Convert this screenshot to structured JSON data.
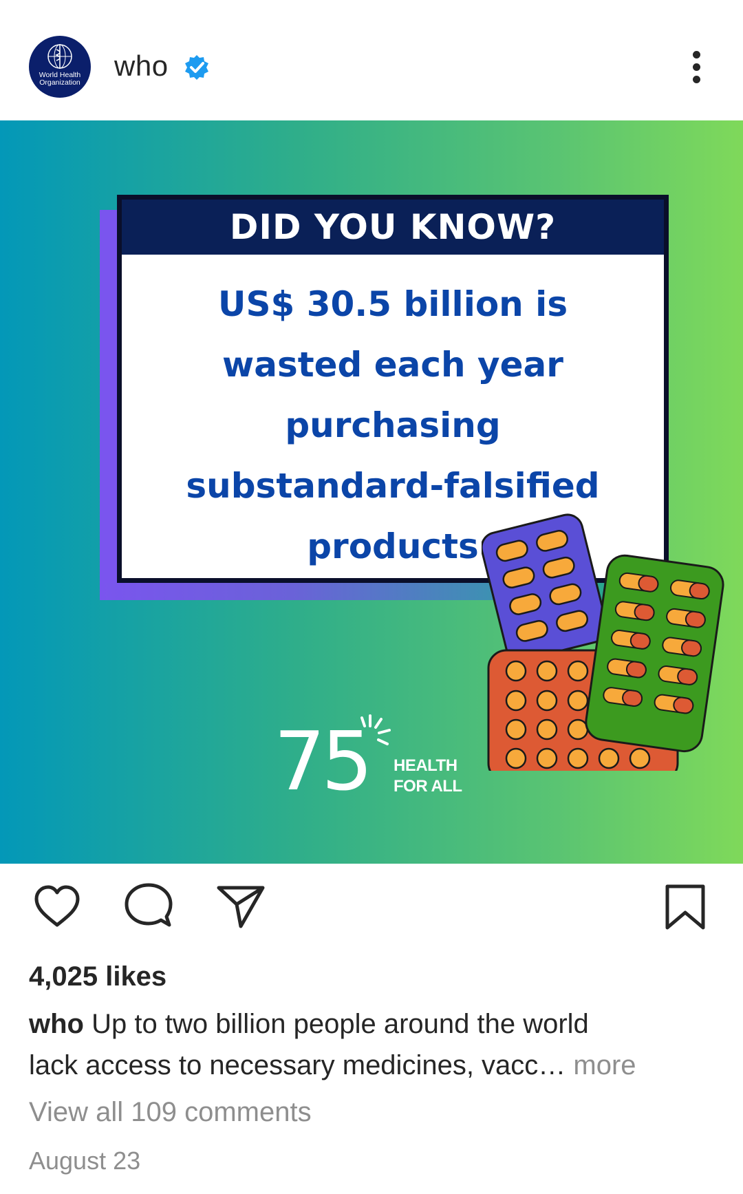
{
  "header": {
    "username": "who",
    "avatar_text_line1": "World Health",
    "avatar_text_line2": "Organization"
  },
  "post_image": {
    "card_title": "DID YOU KNOW?",
    "card_lines": [
      "US$ 30.5 billion is",
      "wasted each year",
      "purchasing",
      "substandard-falsified",
      "products"
    ],
    "anniversary": "75",
    "tag_line1": "HEALTH",
    "tag_line2": "FOR ALL"
  },
  "engagement": {
    "likes": "4,025 likes"
  },
  "caption": {
    "user": "who",
    "line1_text": "Up to two billion people around the world",
    "line2_text": "lack access to necessary medicines, vacc…",
    "more": "more"
  },
  "comments_link": "View all 109 comments",
  "date": "August 23",
  "icons": {
    "header": [
      "verified-badge-icon",
      "more-options-icon"
    ],
    "actions": [
      "heart-icon",
      "comment-icon",
      "share-icon",
      "bookmark-icon"
    ]
  },
  "colors": {
    "verified": "#1d9bf0",
    "card_title_bg": "#0a2057",
    "card_text": "#0b45a8",
    "muted": "#8e8e8e"
  }
}
